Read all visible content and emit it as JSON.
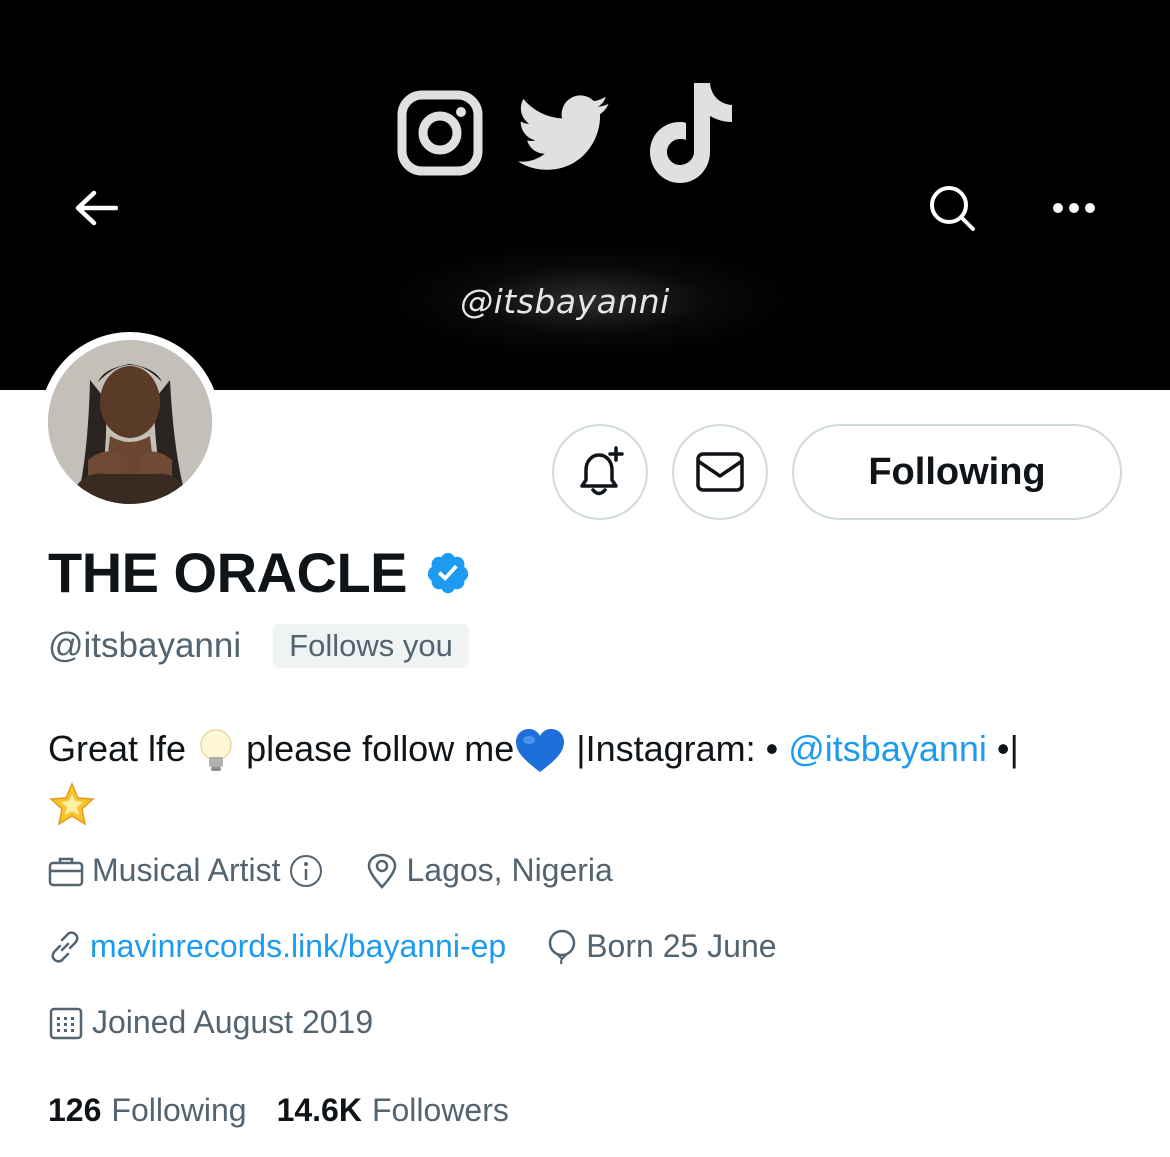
{
  "banner": {
    "handle_text": "@itsbayanni",
    "social_icons": [
      "instagram-icon",
      "twitter-icon",
      "tiktok-icon"
    ]
  },
  "nav": {
    "back_icon": "arrow-left-icon",
    "search_icon": "search-icon",
    "more_icon": "more-horizontal-icon"
  },
  "actions": {
    "notify_icon": "bell-plus-icon",
    "message_icon": "mail-icon",
    "following_label": "Following"
  },
  "profile": {
    "display_name": "THE ORACLE",
    "verified": true,
    "handle": "@itsbayanni",
    "follows_you": "Follows you",
    "bio": {
      "part1": "Great lfe",
      "emoji1": "lightbulb-emoji",
      "part2": " please follow me",
      "emoji2": "blue-heart-emoji",
      "part3": " |Instagram: • ",
      "link": "@itsbayanni",
      "part4": " •|",
      "emoji3": "glowing-star-emoji"
    },
    "category": "Musical Artist",
    "location": "Lagos, Nigeria",
    "website": "mavinrecords.link/bayanni-ep",
    "birthday": "Born 25 June",
    "joined": "Joined August 2019"
  },
  "stats": {
    "following_count": "126",
    "following_label": "Following",
    "followers_count": "14.6K",
    "followers_label": "Followers"
  },
  "colors": {
    "accent": "#1d9bf0",
    "text_primary": "#0f1419",
    "text_secondary": "#536471",
    "border": "#cfd9de",
    "banner_bg": "#000000"
  }
}
